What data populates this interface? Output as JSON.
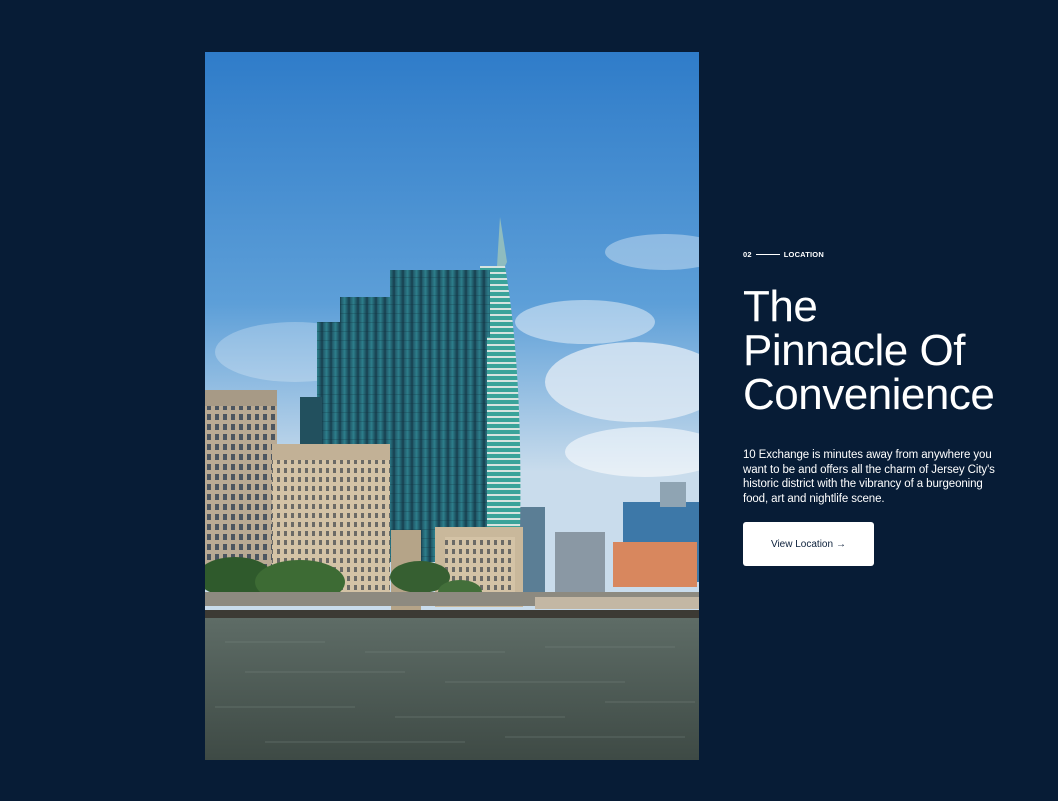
{
  "section": {
    "number": "02",
    "label": "LOCATION"
  },
  "headline": {
    "lines": [
      "The",
      "Pinnacle Of",
      "Convenience"
    ]
  },
  "description": "10 Exchange is minutes away from anywhere you want to be and offers all the charm of Jersey City's historic district with the vibrancy of a burgeoning food, art and nightlife scene.",
  "cta": {
    "label": "View Location",
    "icon": "arrow-right-icon",
    "arrow": "→"
  },
  "colors": {
    "background": "#071c36",
    "text": "#ffffff",
    "button_bg": "#ffffff",
    "button_text": "#0b1f3a"
  }
}
